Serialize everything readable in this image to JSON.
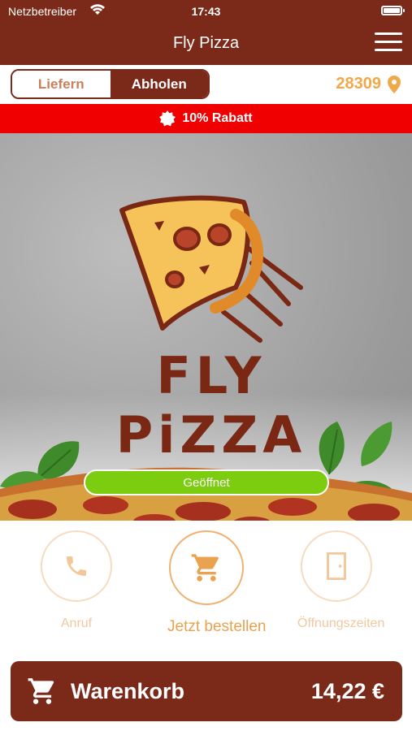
{
  "status_bar": {
    "carrier": "Netzbetreiber",
    "time": "17:43"
  },
  "nav": {
    "title": "Fly Pizza"
  },
  "mode": {
    "deliver": "Liefern",
    "pickup": "Abholen",
    "selected": "pickup"
  },
  "location": {
    "zip": "28309"
  },
  "promo": {
    "text": "10% Rabatt"
  },
  "hero": {
    "logo_text": "FLY PiZZA",
    "status": "Geöffnet"
  },
  "actions": [
    {
      "label": "Anruf"
    },
    {
      "label": "Jetzt bestellen"
    },
    {
      "label": "Öffnungszeiten"
    }
  ],
  "cart": {
    "label": "Warenkorb",
    "total": "14,22 €"
  },
  "colors": {
    "brand": "#7b2a1a",
    "accent": "#f0a94a",
    "promo": "#f00000",
    "open": "#7ccc10"
  }
}
